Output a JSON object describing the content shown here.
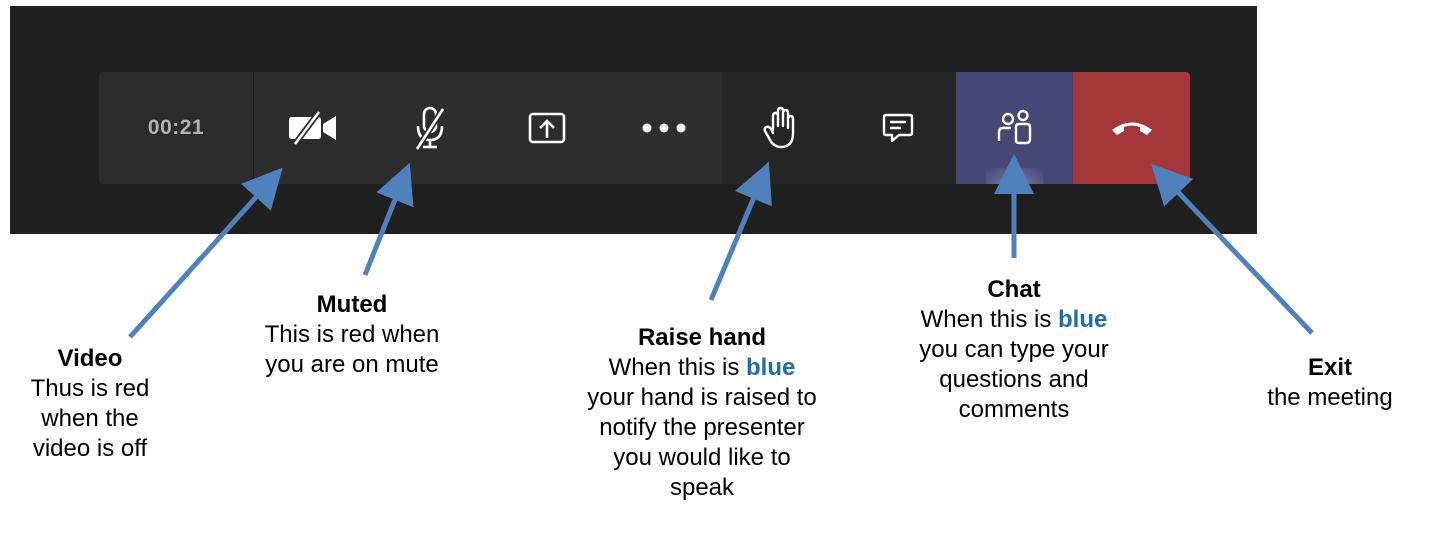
{
  "meeting": {
    "timer": "00:21",
    "buttons": [
      {
        "id": "video",
        "icon": "video-off-icon"
      },
      {
        "id": "mic",
        "icon": "mic-off-icon"
      },
      {
        "id": "share",
        "icon": "share-screen-icon"
      },
      {
        "id": "more",
        "icon": "more-options-icon"
      },
      {
        "id": "raise-hand",
        "icon": "hand-icon"
      },
      {
        "id": "chat",
        "icon": "chat-icon"
      },
      {
        "id": "participants",
        "icon": "participants-icon"
      },
      {
        "id": "hangup",
        "icon": "phone-hangup-icon"
      }
    ]
  },
  "colors": {
    "toolbar_bg": "#2d2d2d",
    "stage_bg": "#202020",
    "participants_active": "#464775",
    "hangup": "#a4373a",
    "annotation_arrow": "#4f81bd",
    "highlight_text": "#1f6ea8"
  },
  "annotations": {
    "video": {
      "title": "Video",
      "lines": [
        "Thus is red",
        "when the",
        "video is off"
      ]
    },
    "muted": {
      "title": "Muted",
      "lines": [
        "This is red when",
        "you are on mute"
      ]
    },
    "raise": {
      "title": "Raise hand",
      "line1_pre": "When this is ",
      "line1_blue": "blue",
      "lines": [
        "your hand is raised to",
        "notify the presenter",
        "you would like to",
        "speak"
      ]
    },
    "chat": {
      "title": "Chat",
      "line1_pre": "When this is ",
      "line1_blue": "blue",
      "lines": [
        "you can type your",
        "questions and",
        "comments"
      ]
    },
    "exit": {
      "title": "Exit",
      "lines": [
        "the meeting"
      ]
    }
  }
}
